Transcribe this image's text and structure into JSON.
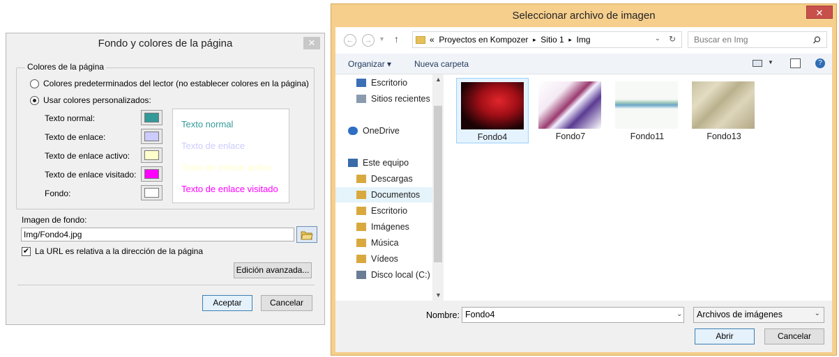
{
  "left_dialog": {
    "title": "Fondo y colores de la página",
    "close": "✕",
    "group_label": "Colores de la página",
    "radio_default": "Colores predeterminados del lector (no establecer colores en la página)",
    "radio_custom": "Usar colores personalizados:",
    "color_rows": [
      {
        "label": "Texto normal:",
        "color": "#339999"
      },
      {
        "label": "Texto de enlace:",
        "color": "#ccccff"
      },
      {
        "label": "Texto de enlace activo:",
        "color": "#ffffcc"
      },
      {
        "label": "Texto de enlace visitado:",
        "color": "#ff00ff"
      },
      {
        "label": "Fondo:",
        "color": "#ffffff"
      }
    ],
    "preview": {
      "normal": "Texto normal",
      "link": "Texto de enlace",
      "active": "Texto de enlace activo",
      "visited": "Texto de enlace visitado"
    },
    "bg_image_label": "Imagen de fondo:",
    "bg_image_value": "Img/Fondo4.jpg",
    "relative_url_label": "La URL es relativa a la dirección de la página",
    "relative_url_checked": true,
    "advanced_button": "Edición avanzada...",
    "ok_button": "Aceptar",
    "cancel_button": "Cancelar"
  },
  "file_dialog": {
    "title": "Seleccionar archivo de imagen",
    "close": "✕",
    "breadcrumb": [
      "«",
      "Proyectos en Kompozer",
      "▸",
      "Sitio 1",
      "▸",
      "Img"
    ],
    "search_placeholder": "Buscar en Img",
    "toolbar": {
      "organize": "Organizar ▾",
      "new_folder": "Nueva carpeta"
    },
    "nav_items": [
      {
        "label": "Escritorio",
        "icon_color": "#3b6fb6"
      },
      {
        "label": "Sitios recientes",
        "icon_color": "#8a9bb0"
      },
      {
        "label": "OneDrive",
        "icon_color": "#2e6fc4"
      },
      {
        "label": "Este equipo",
        "icon_color": "#3a6aa8"
      },
      {
        "label": "Descargas",
        "icon_color": "#d9a93f"
      },
      {
        "label": "Documentos",
        "icon_color": "#d9a93f"
      },
      {
        "label": "Escritorio",
        "icon_color": "#d9a93f"
      },
      {
        "label": "Imágenes",
        "icon_color": "#d9a93f"
      },
      {
        "label": "Música",
        "icon_color": "#d9a93f"
      },
      {
        "label": "Vídeos",
        "icon_color": "#d9a93f"
      },
      {
        "label": "Disco local (C:)",
        "icon_color": "#6b7d94"
      }
    ],
    "files": [
      {
        "name": "Fondo4",
        "selected": true
      },
      {
        "name": "Fondo7",
        "selected": false
      },
      {
        "name": "Fondo11",
        "selected": false
      },
      {
        "name": "Fondo13",
        "selected": false
      }
    ],
    "name_label": "Nombre:",
    "name_value": "Fondo4",
    "file_type": "Archivos de imágenes",
    "open_button": "Abrir",
    "cancel_button": "Cancelar"
  }
}
